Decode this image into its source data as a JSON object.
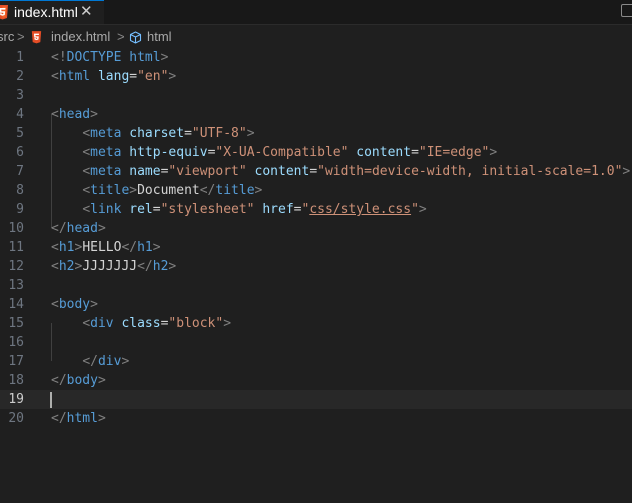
{
  "tab": {
    "label": "index.html",
    "close": "✕"
  },
  "breadcrumb": {
    "items": [
      "src",
      "index.html",
      "html"
    ],
    "separator": ">"
  },
  "editor": {
    "current_line": 19,
    "lines": [
      {
        "n": "1",
        "tokens": [
          [
            "brk",
            "<!"
          ],
          [
            "tag",
            "DOCTYPE html"
          ],
          [
            "brk",
            ">"
          ]
        ]
      },
      {
        "n": "2",
        "tokens": [
          [
            "brk",
            "<"
          ],
          [
            "tag",
            "html"
          ],
          [
            "txt",
            " "
          ],
          [
            "attr",
            "lang"
          ],
          [
            "txt",
            "="
          ],
          [
            "str",
            "\"en\""
          ],
          [
            "brk",
            ">"
          ]
        ]
      },
      {
        "n": "3",
        "tokens": []
      },
      {
        "n": "4",
        "tokens": [
          [
            "brk",
            "<"
          ],
          [
            "tag",
            "head"
          ],
          [
            "brk",
            ">"
          ]
        ]
      },
      {
        "n": "5",
        "tokens": [
          [
            "txt",
            "    "
          ],
          [
            "brk",
            "<"
          ],
          [
            "tag",
            "meta"
          ],
          [
            "txt",
            " "
          ],
          [
            "attr",
            "charset"
          ],
          [
            "txt",
            "="
          ],
          [
            "str",
            "\"UTF-8\""
          ],
          [
            "brk",
            ">"
          ]
        ]
      },
      {
        "n": "6",
        "tokens": [
          [
            "txt",
            "    "
          ],
          [
            "brk",
            "<"
          ],
          [
            "tag",
            "meta"
          ],
          [
            "txt",
            " "
          ],
          [
            "attr",
            "http-equiv"
          ],
          [
            "txt",
            "="
          ],
          [
            "str",
            "\"X-UA-Compatible\""
          ],
          [
            "txt",
            " "
          ],
          [
            "attr",
            "content"
          ],
          [
            "txt",
            "="
          ],
          [
            "str",
            "\"IE=edge\""
          ],
          [
            "brk",
            ">"
          ]
        ]
      },
      {
        "n": "7",
        "tokens": [
          [
            "txt",
            "    "
          ],
          [
            "brk",
            "<"
          ],
          [
            "tag",
            "meta"
          ],
          [
            "txt",
            " "
          ],
          [
            "attr",
            "name"
          ],
          [
            "txt",
            "="
          ],
          [
            "str",
            "\"viewport\""
          ],
          [
            "txt",
            " "
          ],
          [
            "attr",
            "content"
          ],
          [
            "txt",
            "="
          ],
          [
            "str",
            "\"width=device-width, initial-scale=1.0\""
          ],
          [
            "brk",
            ">"
          ]
        ]
      },
      {
        "n": "8",
        "tokens": [
          [
            "txt",
            "    "
          ],
          [
            "brk",
            "<"
          ],
          [
            "tag",
            "title"
          ],
          [
            "brk",
            ">"
          ],
          [
            "txt",
            "Document"
          ],
          [
            "brk",
            "</"
          ],
          [
            "tag",
            "title"
          ],
          [
            "brk",
            ">"
          ]
        ]
      },
      {
        "n": "9",
        "tokens": [
          [
            "txt",
            "    "
          ],
          [
            "brk",
            "<"
          ],
          [
            "tag",
            "link"
          ],
          [
            "txt",
            " "
          ],
          [
            "attr",
            "rel"
          ],
          [
            "txt",
            "="
          ],
          [
            "str",
            "\"stylesheet\""
          ],
          [
            "txt",
            " "
          ],
          [
            "attr",
            "href"
          ],
          [
            "txt",
            "="
          ],
          [
            "str",
            "\""
          ],
          [
            "link",
            "css/style.css"
          ],
          [
            "str",
            "\""
          ],
          [
            "brk",
            ">"
          ]
        ]
      },
      {
        "n": "10",
        "tokens": [
          [
            "brk",
            "</"
          ],
          [
            "tag",
            "head"
          ],
          [
            "brk",
            ">"
          ]
        ]
      },
      {
        "n": "11",
        "tokens": [
          [
            "brk",
            "<"
          ],
          [
            "tag",
            "h1"
          ],
          [
            "brk",
            ">"
          ],
          [
            "txt",
            "HELLO"
          ],
          [
            "brk",
            "</"
          ],
          [
            "tag",
            "h1"
          ],
          [
            "brk",
            ">"
          ]
        ]
      },
      {
        "n": "12",
        "tokens": [
          [
            "brk",
            "<"
          ],
          [
            "tag",
            "h2"
          ],
          [
            "brk",
            ">"
          ],
          [
            "txt",
            "JJJJJJJ"
          ],
          [
            "brk",
            "</"
          ],
          [
            "tag",
            "h2"
          ],
          [
            "brk",
            ">"
          ]
        ]
      },
      {
        "n": "13",
        "tokens": []
      },
      {
        "n": "14",
        "tokens": [
          [
            "brk",
            "<"
          ],
          [
            "tag",
            "body"
          ],
          [
            "brk",
            ">"
          ]
        ]
      },
      {
        "n": "15",
        "tokens": [
          [
            "txt",
            "    "
          ],
          [
            "brk",
            "<"
          ],
          [
            "tag",
            "div"
          ],
          [
            "txt",
            " "
          ],
          [
            "attr",
            "class"
          ],
          [
            "txt",
            "="
          ],
          [
            "str",
            "\"block\""
          ],
          [
            "brk",
            ">"
          ]
        ]
      },
      {
        "n": "16",
        "tokens": []
      },
      {
        "n": "17",
        "tokens": [
          [
            "txt",
            "    "
          ],
          [
            "brk",
            "</"
          ],
          [
            "tag",
            "div"
          ],
          [
            "brk",
            ">"
          ]
        ]
      },
      {
        "n": "18",
        "tokens": [
          [
            "brk",
            "</"
          ],
          [
            "tag",
            "body"
          ],
          [
            "brk",
            ">"
          ]
        ]
      },
      {
        "n": "19",
        "tokens": []
      },
      {
        "n": "20",
        "tokens": [
          [
            "brk",
            "</"
          ],
          [
            "tag",
            "html"
          ],
          [
            "brk",
            ">"
          ]
        ]
      }
    ]
  },
  "colors": {
    "tag": "#569cd6",
    "attr": "#9cdcfe",
    "str": "#ce9178",
    "brk": "#808080",
    "txt": "#d4d4d4",
    "accent": "#0078d4",
    "html_icon": "#e44d26"
  },
  "icons": {
    "tab_file": "html5-icon",
    "tab_close": "close-icon",
    "symbol": "cube-icon",
    "split": "split-editor-icon"
  }
}
